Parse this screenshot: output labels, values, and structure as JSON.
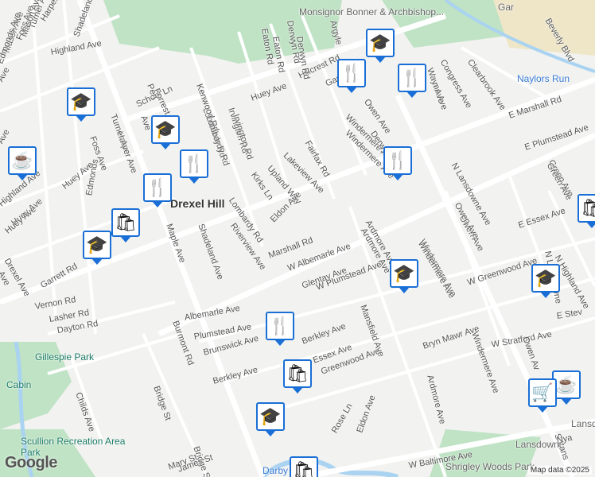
{
  "map": {
    "brand": "Google",
    "attribution": "Map data ©2025",
    "colors": {
      "background": "#f2f2f0",
      "park": "#bfe3c4",
      "water": "#a9d3f1",
      "road": "#ffffff",
      "marker_border": "#1a6fd6"
    }
  },
  "places": {
    "town": "Drexel Hill",
    "school": "Monsignor Bonner & Archbishop...",
    "park1": "Gillespie Park",
    "park2": "Scullion Recreation Area Park",
    "cabin": "Cabin",
    "lansdowne": "Lansdowne",
    "shrigley": "Shrigley Woods Park",
    "creek": "Naylors Run",
    "darby": "Darby Creek",
    "lansdowne_short": "Lansdowne",
    "gar": "Gar"
  },
  "streets": [
    "Shadeland Ave",
    "Harper Ave",
    "Turner Ave",
    "Foss Ave",
    "Mason Ave",
    "Edmonds Ave",
    "Highland Ave",
    "School Ln",
    "Lombardy Rd",
    "Kenwood Rd",
    "Irvington Rd",
    "Eaton Rd",
    "Derwyn Rd",
    "Argyle",
    "Huey Ave",
    "Hillcrest Rd",
    "Garrett Rd",
    "Owen Ave",
    "Wayne Ave",
    "Congress Ave",
    "Clearbrook Ave",
    "Beverly Blvd",
    "E Marshall Rd",
    "E Plumstead Ave",
    "Green Ave",
    "Windermere Ave",
    "Fairfax Rd",
    "Lakeview Ave",
    "Upland Way",
    "Kirks Ln",
    "Lombardy Rd",
    "Riverview Ave",
    "Eldon Ave",
    "Marshall Rd",
    "N Lansdowne Ave",
    "Owen Ave",
    "E Essex Ave",
    "Ardmore Ave",
    "W Albemarle Ave",
    "Glentay Ave",
    "W Plumstead Ave",
    "Windermere Ave",
    "W Greenwood Ave",
    "N Highland Ave",
    "N Lansdowne",
    "E Stev",
    "Maple Ave",
    "Shadeland Ave",
    "Edmonds",
    "Huey Ave",
    "Garrett Rd",
    "Drexel Ave",
    "Vernon Rd",
    "Lasher Rd",
    "Dayton Rd",
    "Albemarle Ave",
    "Plumstead Ave",
    "Brunswick Ave",
    "Berkley Ave",
    "Burmont Rd",
    "Mansfield Ave",
    "Bryn Mawr Ave",
    "W Stratford Ave",
    "Windermere Ave",
    "Owen Av",
    "Berkley Ave",
    "Essex Ave",
    "Greenwood Ave",
    "Bridge St",
    "Childs Ave",
    "Rose Ln",
    "Eldon Ave",
    "Ardmore Ave",
    "Mary St",
    "Bridge St",
    "James St",
    "W Baltimore Ave",
    "S Lans",
    "Nya",
    "Highland Ave",
    "Huey Ave",
    "Ave",
    "Ave",
    "Ave",
    "Forrest Ave",
    "Pen",
    "Ave",
    "n Ave",
    "Harper Ave",
    "Foss Ave",
    "Turner Ave",
    "Mason Ave",
    "Kenwood Rd",
    "Irvington Rd",
    "Lombardy Rd",
    "Eaton Rd",
    "Derwyn Rd",
    "Windermere Ave",
    "Derwyn Rd",
    "Ardmore Ave",
    "Owen Ave",
    "Windermere Ave",
    "Green Ave",
    "Huey Ave"
  ],
  "markers": [
    {
      "name": "school-marker",
      "type": "school",
      "glyph": "🎓"
    },
    {
      "name": "restaurant-marker",
      "type": "restaurant",
      "glyph": "🍴"
    },
    {
      "name": "cafe-marker",
      "type": "cafe",
      "glyph": "☕"
    },
    {
      "name": "shopping-marker",
      "type": "shopping",
      "glyph": "🛍"
    },
    {
      "name": "grocery-marker",
      "type": "grocery",
      "glyph": "🛒"
    }
  ]
}
